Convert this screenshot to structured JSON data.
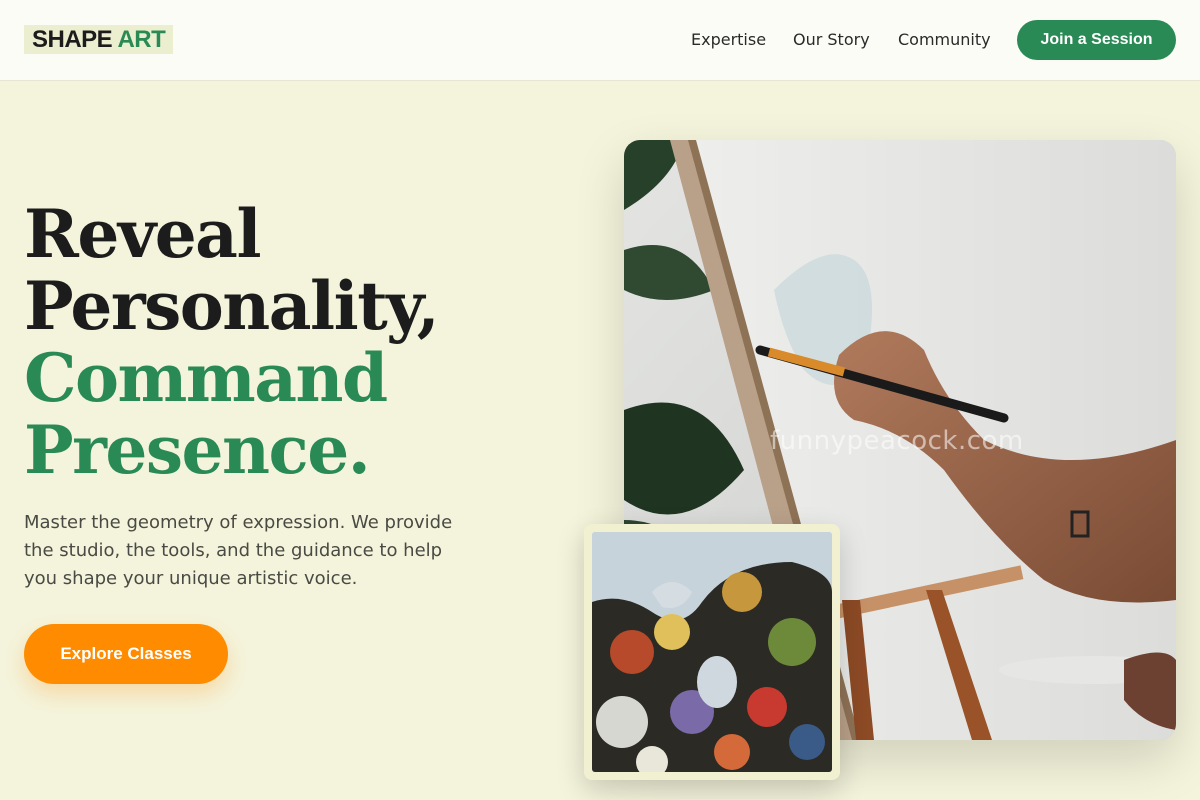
{
  "header": {
    "logo": {
      "part1": "SHAPE",
      "part2": "ART"
    },
    "nav": [
      {
        "label": "Expertise"
      },
      {
        "label": "Our Story"
      },
      {
        "label": "Community"
      }
    ],
    "cta_label": "Join a Session"
  },
  "hero": {
    "headline_dark": [
      "Reveal",
      "Personality,"
    ],
    "headline_green": [
      "Command",
      "Presence."
    ],
    "subtitle": "Master the geometry of expression. We provide the studio, the tools, and the guidance to help you shape your unique artistic voice.",
    "cta_label": "Explore Classes"
  },
  "images": {
    "main_watermark": "funnypeacock.com",
    "main_image_icon": "painting-easel-photo",
    "secondary_image_icon": "paint-palette-photo"
  },
  "colors": {
    "background": "#f4f4dc",
    "brand_green": "#2a8a55",
    "accent_orange": "#ff8c00",
    "header_bg": "#fcfcf6"
  }
}
